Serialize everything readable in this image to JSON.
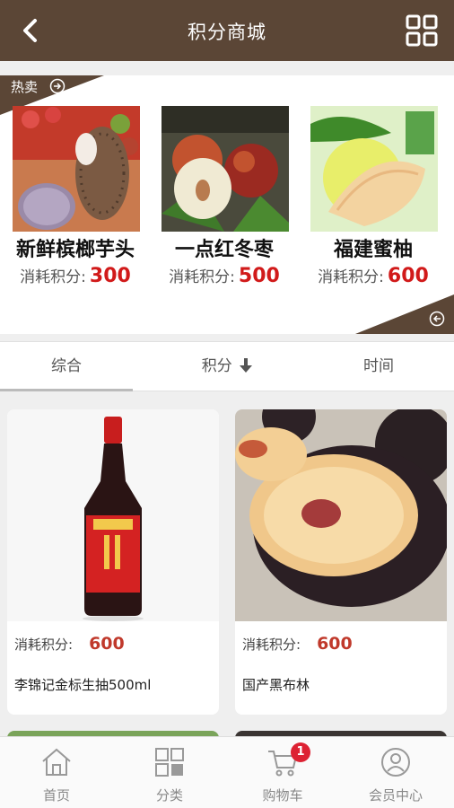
{
  "header": {
    "title": "积分商城"
  },
  "hot": {
    "label": "热卖",
    "items": [
      {
        "name": "新鲜槟榔芋头",
        "price_label": "消耗积分:",
        "price": "300"
      },
      {
        "name": "一点红冬枣",
        "price_label": "消耗积分:",
        "price": "500"
      },
      {
        "name": "福建蜜柚",
        "price_label": "消耗积分:",
        "price": "600"
      }
    ]
  },
  "tabs": [
    {
      "label": "综合",
      "active": true
    },
    {
      "label": "积分",
      "sort_icon": "arrow-down-icon"
    },
    {
      "label": "时间"
    }
  ],
  "products": [
    {
      "price_label": "消耗积分:",
      "price": "600",
      "name": "李锦记金标生抽500ml"
    },
    {
      "price_label": "消耗积分:",
      "price": "600",
      "name": "国产黑布林"
    }
  ],
  "bottom_nav": [
    {
      "label": "首页",
      "icon": "home-icon"
    },
    {
      "label": "分类",
      "icon": "category-icon"
    },
    {
      "label": "购物车",
      "icon": "cart-icon",
      "badge": "1"
    },
    {
      "label": "会员中心",
      "icon": "user-icon"
    }
  ],
  "colors": {
    "header": "#5b4636",
    "price": "#d11a1a",
    "badge": "#dd2233"
  }
}
